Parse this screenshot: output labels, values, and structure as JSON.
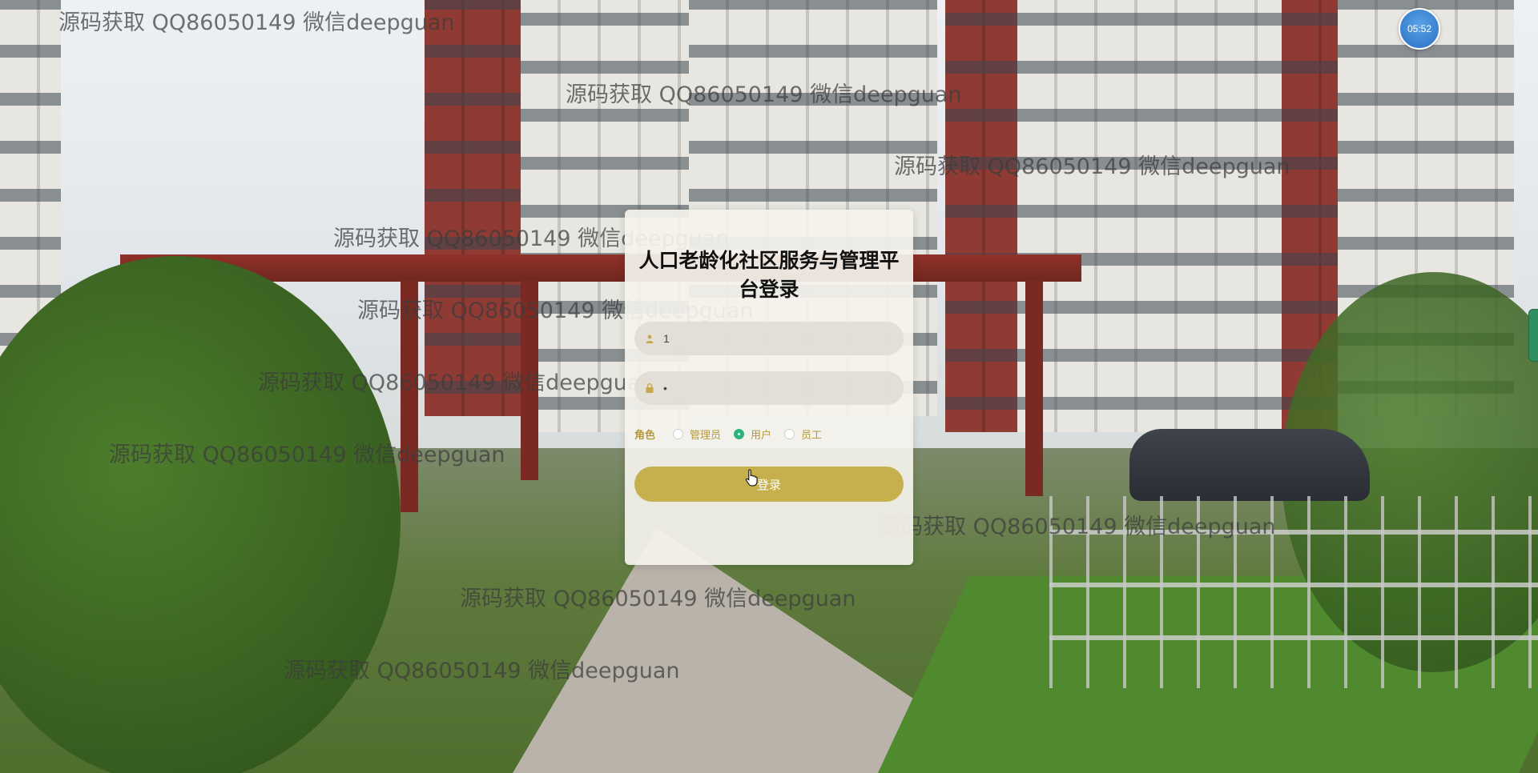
{
  "watermark": {
    "text": "源码获取 QQ86050149 微信deepguan"
  },
  "clock": {
    "time": "05:52"
  },
  "login": {
    "title": "人口老龄化社区服务与管理平台登录",
    "username_value": "1",
    "password_value": "•",
    "role_label": "角色",
    "roles": [
      {
        "label": "管理员",
        "selected": false
      },
      {
        "label": "用户",
        "selected": true
      },
      {
        "label": "员工",
        "selected": false
      }
    ],
    "submit_label": "登录"
  },
  "colors": {
    "accent": "#c6b04e",
    "radio_selected": "#2bb57a",
    "label_gold": "#b5993c"
  },
  "icons": {
    "username": "user-icon",
    "password": "lock-icon"
  }
}
